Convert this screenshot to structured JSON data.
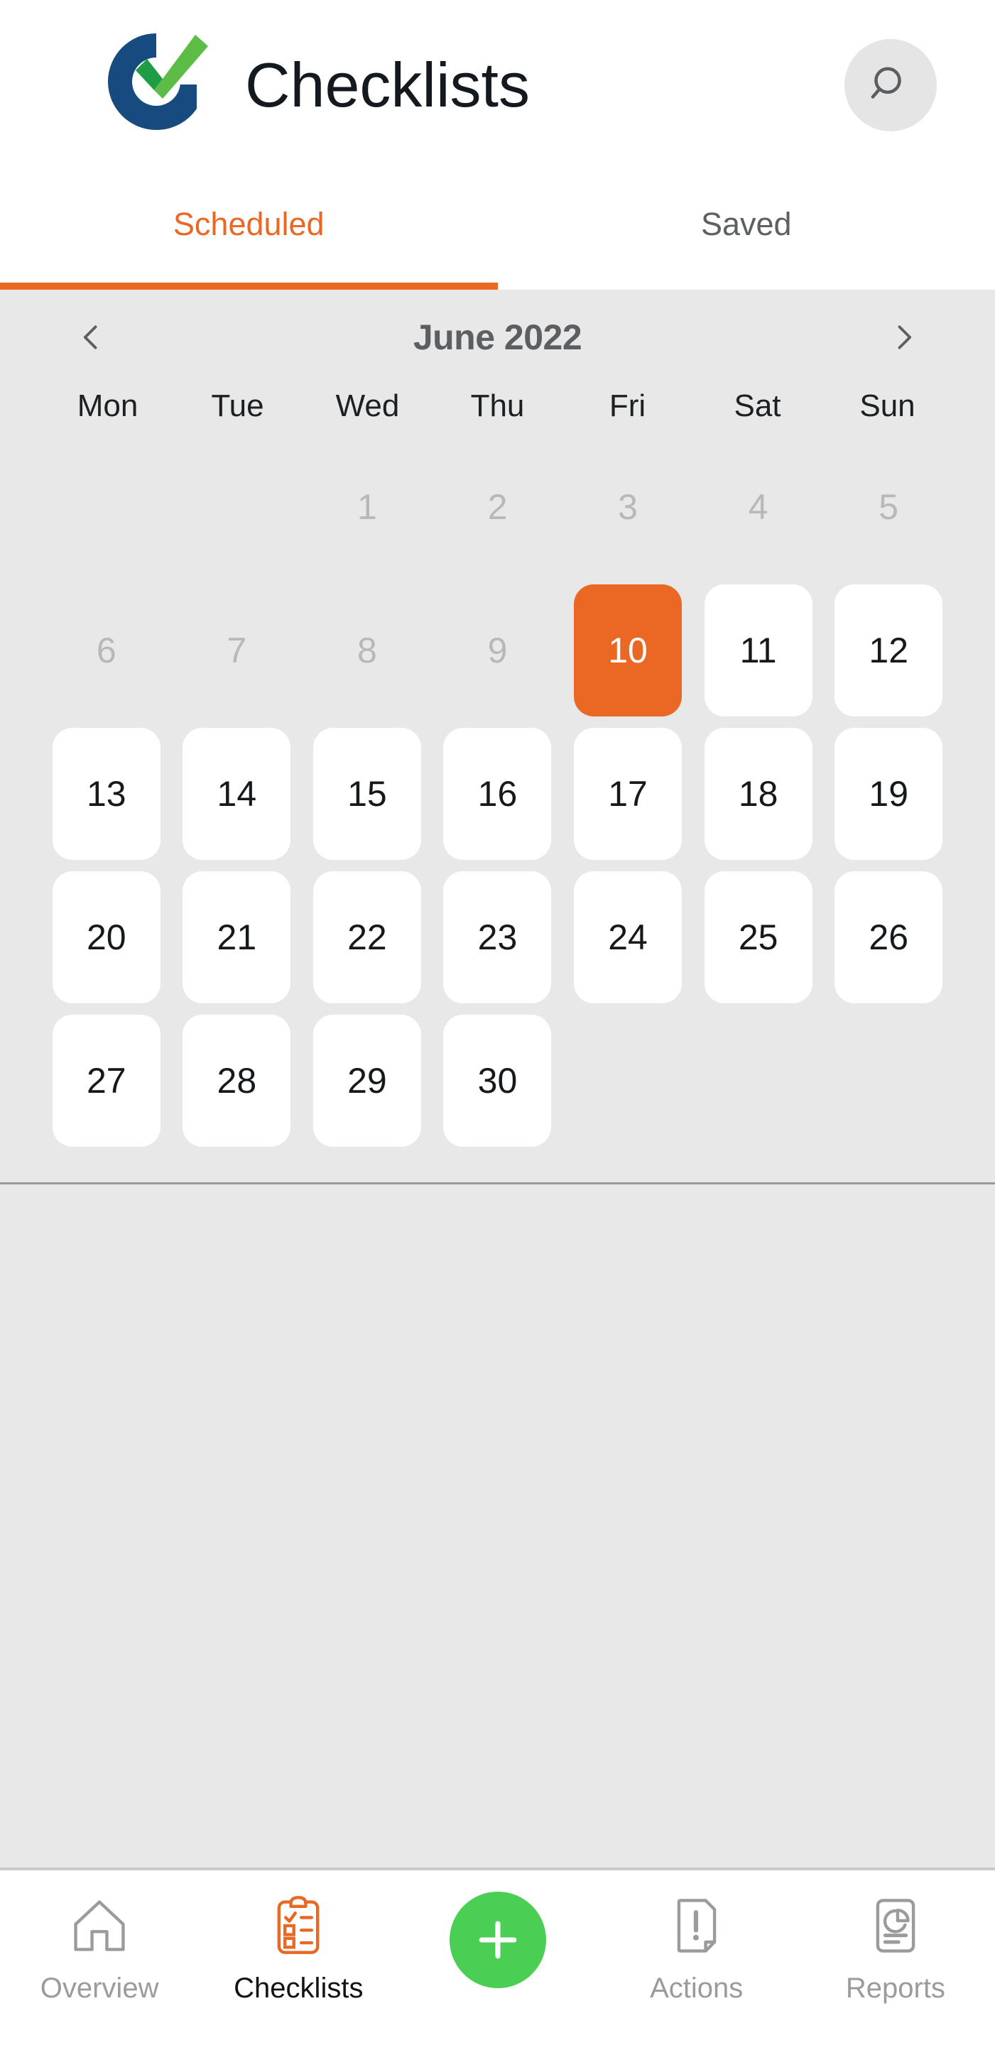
{
  "header": {
    "title": "Checklists",
    "logo_icon": "checkmark-circle-logo",
    "logo_colors": {
      "ring": "#174a7e",
      "check_dark": "#1f9d45",
      "check_light": "#5cbc46"
    },
    "search_icon": "search-icon"
  },
  "tabs": [
    {
      "label": "Scheduled",
      "active": true
    },
    {
      "label": "Saved",
      "active": false
    }
  ],
  "calendar": {
    "month_label": "June 2022",
    "prev_icon": "chevron-left-icon",
    "next_icon": "chevron-right-icon",
    "weekdays": [
      "Mon",
      "Tue",
      "Wed",
      "Thu",
      "Fri",
      "Sat",
      "Sun"
    ],
    "weeks": [
      [
        {
          "day": "",
          "state": "empty"
        },
        {
          "day": "",
          "state": "empty"
        },
        {
          "day": "1",
          "state": "muted"
        },
        {
          "day": "2",
          "state": "muted"
        },
        {
          "day": "3",
          "state": "muted"
        },
        {
          "day": "4",
          "state": "muted"
        },
        {
          "day": "5",
          "state": "muted"
        }
      ],
      [
        {
          "day": "6",
          "state": "muted"
        },
        {
          "day": "7",
          "state": "muted"
        },
        {
          "day": "8",
          "state": "muted"
        },
        {
          "day": "9",
          "state": "muted"
        },
        {
          "day": "10",
          "state": "selected"
        },
        {
          "day": "11",
          "state": "normal"
        },
        {
          "day": "12",
          "state": "normal"
        }
      ],
      [
        {
          "day": "13",
          "state": "normal"
        },
        {
          "day": "14",
          "state": "normal"
        },
        {
          "day": "15",
          "state": "normal"
        },
        {
          "day": "16",
          "state": "normal"
        },
        {
          "day": "17",
          "state": "normal"
        },
        {
          "day": "18",
          "state": "normal"
        },
        {
          "day": "19",
          "state": "normal"
        }
      ],
      [
        {
          "day": "20",
          "state": "normal"
        },
        {
          "day": "21",
          "state": "normal"
        },
        {
          "day": "22",
          "state": "normal"
        },
        {
          "day": "23",
          "state": "normal"
        },
        {
          "day": "24",
          "state": "normal"
        },
        {
          "day": "25",
          "state": "normal"
        },
        {
          "day": "26",
          "state": "normal"
        }
      ],
      [
        {
          "day": "27",
          "state": "normal"
        },
        {
          "day": "28",
          "state": "normal"
        },
        {
          "day": "29",
          "state": "normal"
        },
        {
          "day": "30",
          "state": "normal"
        },
        {
          "day": "",
          "state": "empty"
        },
        {
          "day": "",
          "state": "empty"
        },
        {
          "day": "",
          "state": "empty"
        }
      ]
    ]
  },
  "bottom_nav": {
    "items": [
      {
        "label": "Overview",
        "icon": "home-icon",
        "active": false
      },
      {
        "label": "Checklists",
        "icon": "clipboard-checklist-icon",
        "active": true
      },
      {
        "label": "",
        "icon": "plus-icon",
        "active": false
      },
      {
        "label": "Actions",
        "icon": "document-exclamation-icon",
        "active": false
      },
      {
        "label": "Reports",
        "icon": "document-chart-icon",
        "active": false
      }
    ]
  },
  "colors": {
    "accent_orange": "#ea6724",
    "fab_green": "#4ace53",
    "page_background": "#e8e8e8",
    "surface_white": "#ffffff",
    "muted_text": "#b8b8b8",
    "icon_gray": "#9b9b9b"
  }
}
